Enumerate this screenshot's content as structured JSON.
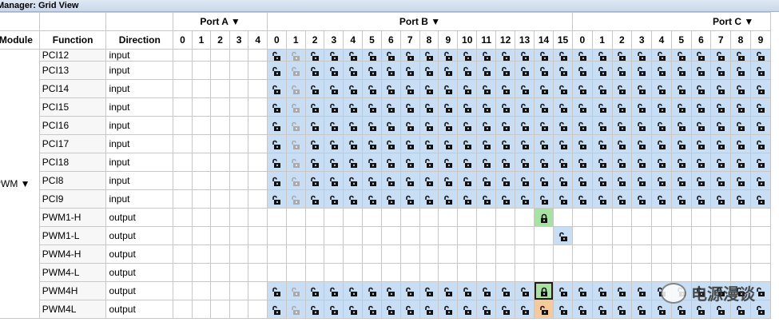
{
  "window": {
    "title": "Manager: Grid View"
  },
  "headers": {
    "module": "Module",
    "function": "Function",
    "direction": "Direction",
    "ports": [
      {
        "label": "Port A ▼",
        "pins": [
          "0",
          "1",
          "2",
          "3",
          "4"
        ]
      },
      {
        "label": "Port B ▼",
        "pins": [
          "0",
          "1",
          "2",
          "3",
          "4",
          "5",
          "6",
          "7",
          "8",
          "9",
          "10",
          "11",
          "12",
          "13",
          "14",
          "15"
        ]
      },
      {
        "label": "Port C ▼",
        "pins": [
          "0",
          "1",
          "2",
          "3",
          "4",
          "5",
          "6",
          "7",
          "8",
          "9"
        ]
      }
    ]
  },
  "module_label": "PWM ▼",
  "rows": [
    {
      "function": "PCI12",
      "direction": "input",
      "cells": "_____UuUUUUUUUUUUUUUUUUUUUUUUUUUUU",
      "partial": true
    },
    {
      "function": "PCI13",
      "direction": "input",
      "cells": "_____UuUUUUUUUUUUUUUUUUUUUUUUUUUUU"
    },
    {
      "function": "PCI14",
      "direction": "input",
      "cells": "_____UuUUUUUUUUUUUUUUUUUUUUUUUUUUU"
    },
    {
      "function": "PCI15",
      "direction": "input",
      "cells": "_____UuUUUUUUUUUUUUUUUUUUUUUUUUUUU"
    },
    {
      "function": "PCI16",
      "direction": "input",
      "cells": "_____UuUUUUUUUUUUUUUUUUUUUUUUUUUUU"
    },
    {
      "function": "PCI17",
      "direction": "input",
      "cells": "_____UuUUUUUUUUUUUUUUUUUUUUUUUUUUU"
    },
    {
      "function": "PCI18",
      "direction": "input",
      "cells": "_____UuUUUUUUUUUUUUUUUUUUUUUUUUUUU"
    },
    {
      "function": "PCI8",
      "direction": "input",
      "cells": "_____UuUUUUUUUUUUUUUUUUUUUUUUUUUUU"
    },
    {
      "function": "PCI9",
      "direction": "input",
      "cells": "_____UuUUUUUUUUUUUUUUUUUUUUUUUUUUU"
    },
    {
      "function": "PWM1-H",
      "direction": "output",
      "cells": "___________________L_______________"
    },
    {
      "function": "PWM1-L",
      "direction": "output",
      "cells": "____________________U______________"
    },
    {
      "function": "PWM4-H",
      "direction": "output",
      "cells": "___________________________________"
    },
    {
      "function": "PWM4-L",
      "direction": "output",
      "cells": "___________________________________"
    },
    {
      "function": "PWM4H",
      "direction": "output",
      "cells": "_____UuUUUUUUUUUUUUSUUUUUUUUUUUUUU"
    },
    {
      "function": "PWM4L",
      "direction": "output",
      "cells": "_____UuUUUUUUUUUUUUOUUUUUUUUUUUUUU"
    }
  ],
  "icons": {
    "unlock": "unlock-icon",
    "lock": "lock-icon"
  },
  "colors": {
    "available": "#c7def4",
    "locked": "#a6e3a0",
    "conflict": "#f6c99a"
  },
  "watermark": {
    "text": "电源漫谈"
  }
}
